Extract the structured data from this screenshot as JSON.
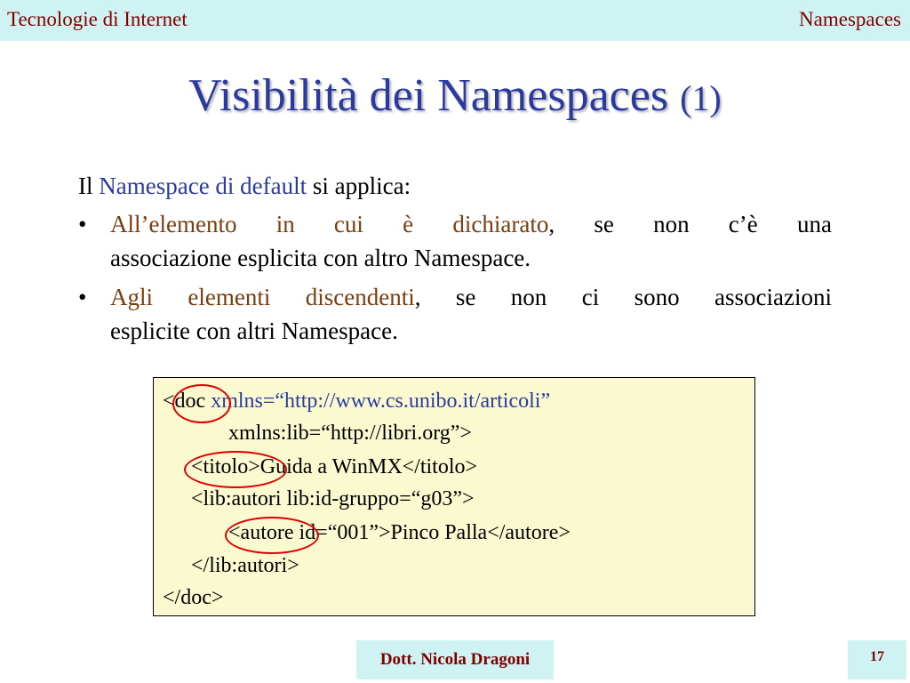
{
  "header": {
    "left": "Tecnologie di Internet",
    "right": "Namespaces"
  },
  "title": {
    "main": "Visibilità dei Namespaces",
    "number": "(1)"
  },
  "intro": {
    "prefix": "Il",
    "highlight": "Namespace di default",
    "suffix": "si applica:"
  },
  "bullets": [
    {
      "highlight": "All’elemento in cui è dichiarato",
      "rest": ", se non c’è una",
      "line2": "associazione esplicita con altro Namespace."
    },
    {
      "highlight": "Agli elementi discendenti",
      "rest": ", se non ci sono associazioni",
      "line2": "esplicite con altri Namespace."
    }
  ],
  "bullet_symbol": "•",
  "code": {
    "line1_tag": "<doc",
    "line1_attr": "xmlns=“http://www.cs.unibo.it/articoli”",
    "line2": "xmlns:lib=“http://libri.org”>",
    "line3": "<titolo>Guida a WinMX</titolo>",
    "line4": "<lib:autori lib:id-gruppo=“g03”>",
    "line5": "<autore id=“001”>Pinco Palla</autore>",
    "line6": "</lib:autori>",
    "line7": "</doc>"
  },
  "footer": {
    "author": "Dott. Nicola Dragoni",
    "page": "17"
  },
  "colors": {
    "accent_blue": "#2b3aa0",
    "highlight_brown": "#7a3d10",
    "bar_cyan": "#cff3f3",
    "bar_text": "#800000",
    "code_bg": "#fbf9cf",
    "circle_red": "#dd0000"
  }
}
